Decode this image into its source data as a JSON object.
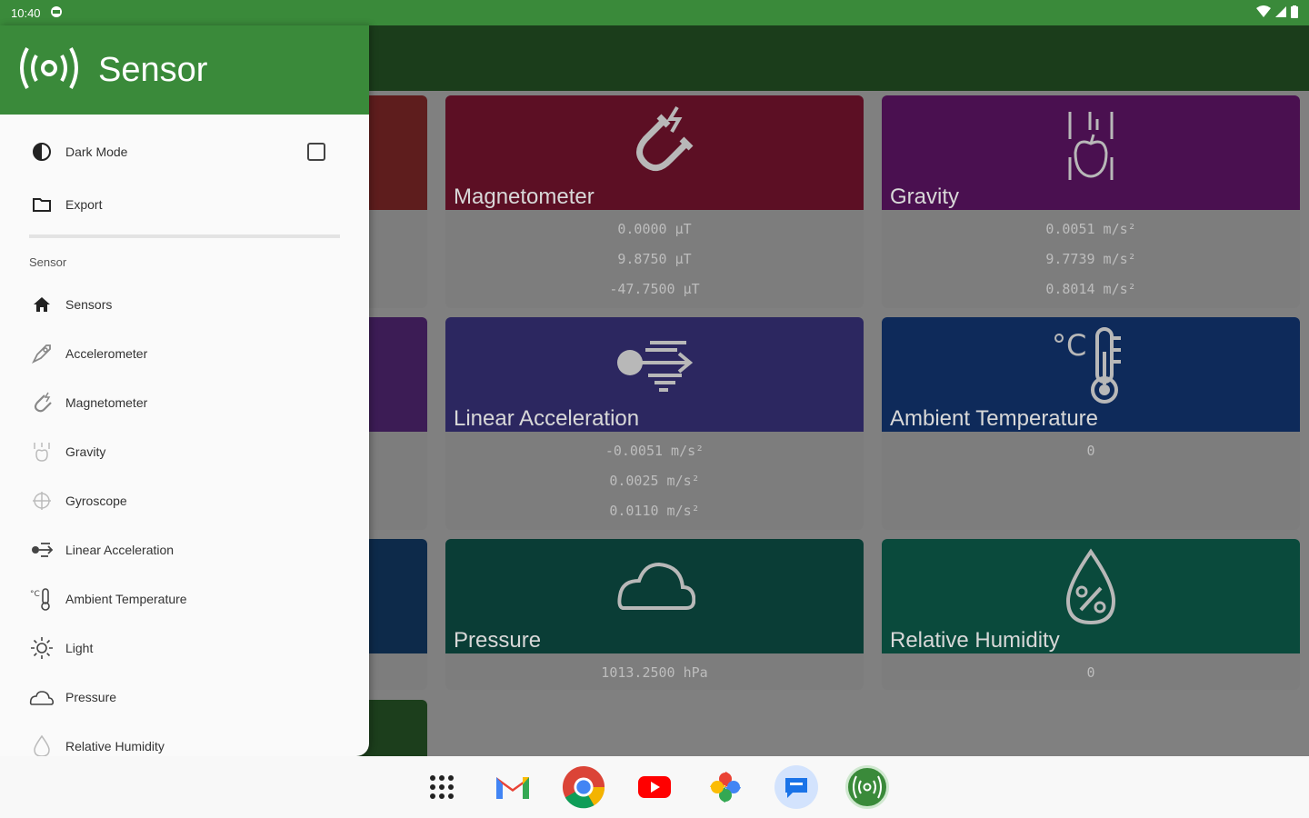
{
  "status_bar": {
    "time": "10:40"
  },
  "drawer": {
    "title": "Sensor",
    "dark_mode_label": "Dark Mode",
    "export_label": "Export",
    "section_label": "Sensor",
    "items": [
      {
        "label": "Sensors",
        "icon": "home-icon"
      },
      {
        "label": "Accelerometer",
        "icon": "rocket-icon"
      },
      {
        "label": "Magnetometer",
        "icon": "magnet-icon"
      },
      {
        "label": "Gravity",
        "icon": "apple-gravity-icon"
      },
      {
        "label": "Gyroscope",
        "icon": "gyroscope-icon"
      },
      {
        "label": "Linear Acceleration",
        "icon": "linear-acceleration-icon"
      },
      {
        "label": "Ambient Temperature",
        "icon": "thermometer-icon"
      },
      {
        "label": "Light",
        "icon": "sun-icon"
      },
      {
        "label": "Pressure",
        "icon": "cloud-icon"
      },
      {
        "label": "Relative Humidity",
        "icon": "humidity-icon"
      }
    ]
  },
  "cards": {
    "magnetometer": {
      "title": "Magnetometer",
      "values": [
        "0.0000 µT",
        "9.8750 µT",
        "-47.7500 µT"
      ],
      "color": "#5c0f24"
    },
    "gravity": {
      "title": "Gravity",
      "values": [
        "0.0051 m/s²",
        "9.7739 m/s²",
        "0.8014 m/s²"
      ],
      "color": "#4a1050"
    },
    "linear_acceleration": {
      "title": "Linear Acceleration",
      "values": [
        "-0.0051 m/s²",
        "0.0025 m/s²",
        "0.0110 m/s²"
      ],
      "color": "#2c2760"
    },
    "ambient_temperature": {
      "title": "Ambient Temperature",
      "values": [
        "0"
      ],
      "color": "#0e2a5a"
    },
    "pressure": {
      "title": "Pressure",
      "values": [
        "1013.2500 hPa"
      ],
      "color": "#0a3d36"
    },
    "relative_humidity": {
      "title": "Relative Humidity",
      "values": [
        "0"
      ],
      "color": "#0a4a3c"
    }
  },
  "partial_cards_colors": [
    "#5e1d1d",
    "#3c1c55",
    "#0d2a4a",
    "#1c3e1c"
  ],
  "dock": [
    "apps-grid-icon",
    "gmail-icon",
    "chrome-icon",
    "youtube-icon",
    "photos-icon",
    "messages-icon",
    "sensor-app-icon"
  ]
}
